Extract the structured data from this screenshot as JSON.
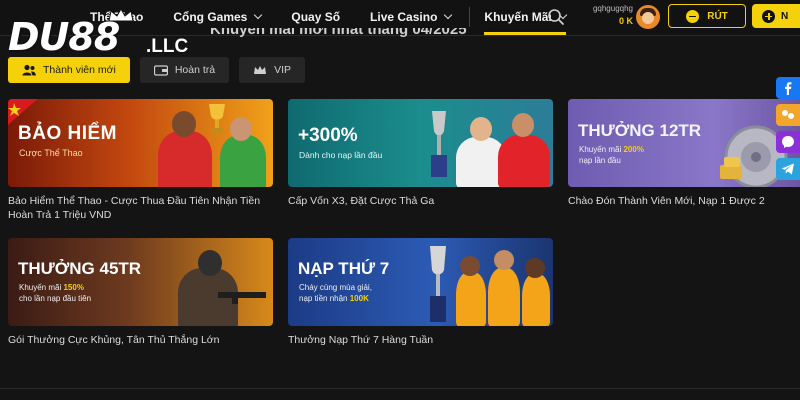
{
  "header": {
    "nav": [
      {
        "label": "Thể Thao",
        "dropdown": false
      },
      {
        "label": "Cổng Games",
        "dropdown": true
      },
      {
        "label": "Quay Số",
        "dropdown": false
      },
      {
        "label": "Live Casino",
        "dropdown": true
      },
      {
        "label": "Khuyến Mãi",
        "dropdown": true,
        "active": true
      }
    ],
    "account_name": "gqhgugqhg",
    "balance": "0 K",
    "withdraw_label": "RÚT",
    "deposit_label": "N"
  },
  "logo": {
    "main": "DU88",
    "tld": ".LLC"
  },
  "page_heading": "Khuyến mãi mới nhất tháng 04/2025",
  "tabs": [
    {
      "label": "Thành viên mới",
      "active": true,
      "icon": "users-icon"
    },
    {
      "label": "Hoàn trả",
      "active": false,
      "icon": "wallet-icon"
    },
    {
      "label": "VIP",
      "active": false,
      "icon": "crown-icon"
    }
  ],
  "promos": [
    {
      "banner_title": "BẢO HIỂM",
      "banner_sub": "Cược Thể Thao",
      "title": "Bảo Hiểm Thể Thao - Cược Thua Đầu Tiên Nhận Tiền Hoàn Trả 1 Triệu VND"
    },
    {
      "banner_title": "+300%",
      "banner_sub": "Dành cho nạp lần đầu",
      "title": "Cấp Vốn X3, Đặt Cược Thả Ga"
    },
    {
      "banner_title": "THƯỞNG 12TR",
      "banner_sub_a": "Khuyến mãi ",
      "banner_sub_hl": "200%",
      "banner_sub_b": "nạp lần đầu",
      "title": "Chào Đón Thành Viên Mới, Nạp 1 Được 2"
    },
    {
      "banner_title": "THƯỞNG 45TR",
      "banner_sub_a": "Khuyến mãi ",
      "banner_sub_hl": "150%",
      "banner_sub_b": "cho lần nạp đầu tiên",
      "title": "Gói Thưởng Cực Khủng, Tân Thủ Thắng Lớn"
    },
    {
      "banner_title": "NẠP THỨ 7",
      "banner_sub_a": "Cháy cùng mùa giải,",
      "banner_sub_b": "nạp tiền nhận ",
      "banner_sub_hl": "100K",
      "title": "Thưởng Nạp Thứ 7 Hàng Tuần"
    }
  ],
  "social": [
    "facebook-icon",
    "group-chat-icon",
    "messenger-icon",
    "telegram-icon"
  ],
  "colors": {
    "accent": "#f5d10a",
    "background": "#141414",
    "tab_bg": "#262626"
  }
}
